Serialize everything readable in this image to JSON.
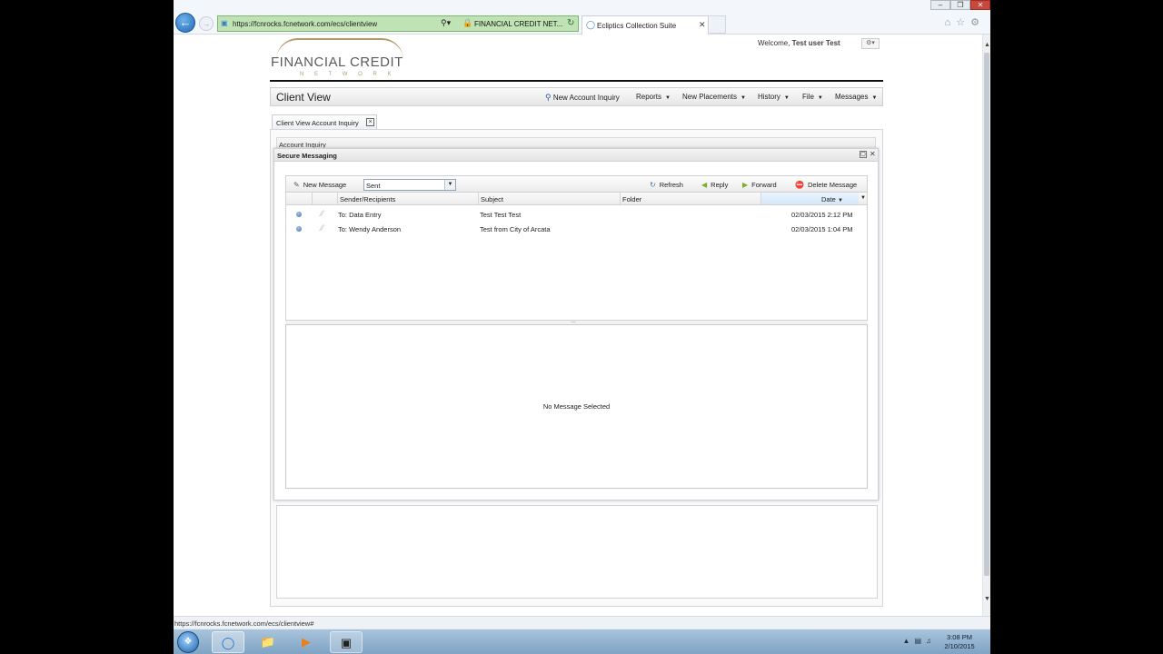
{
  "browser": {
    "url": "https://fcnrocks.fcnetwork.com/ecs/clientview",
    "cert_label": "FINANCIAL CREDIT NET...",
    "tab_title": "Ecliptics Collection Suite",
    "status_url": "https://fcnrocks.fcnetwork.com/ecs/clientview#"
  },
  "header": {
    "logo_main": "FINANCIAL CREDIT",
    "logo_sub": "N E T W O R K",
    "welcome_prefix": "Welcome,",
    "user_name": "Test user Test"
  },
  "topbar": {
    "title": "Client View",
    "menu": {
      "new_account_inquiry": "New Account Inquiry",
      "reports": "Reports",
      "new_placements": "New Placements",
      "history": "History",
      "file": "File",
      "messages": "Messages"
    }
  },
  "subtab": {
    "label": "Client View Account Inquiry"
  },
  "account_inquiry": {
    "label": "Account Inquiry"
  },
  "secure_messaging": {
    "title": "Secure Messaging",
    "toolbar": {
      "new_message": "New Message",
      "folder": "Sent",
      "refresh": "Refresh",
      "reply": "Reply",
      "forward": "Forward",
      "delete_message": "Delete Message"
    },
    "columns": {
      "sender": "Sender/Recipients",
      "subject": "Subject",
      "folder": "Folder",
      "date": "Date"
    },
    "rows": [
      {
        "recipient": "To: Data Entry",
        "subject": "Test Test Test",
        "folder": "",
        "date": "02/03/2015 2:12 PM"
      },
      {
        "recipient": "To: Wendy Anderson",
        "subject": "Test from City of Arcata",
        "folder": "",
        "date": "02/03/2015 1:04 PM"
      }
    ],
    "preview_empty": "No Message Selected"
  },
  "taskbar": {
    "time": "3:08 PM",
    "date": "2/10/2015"
  }
}
